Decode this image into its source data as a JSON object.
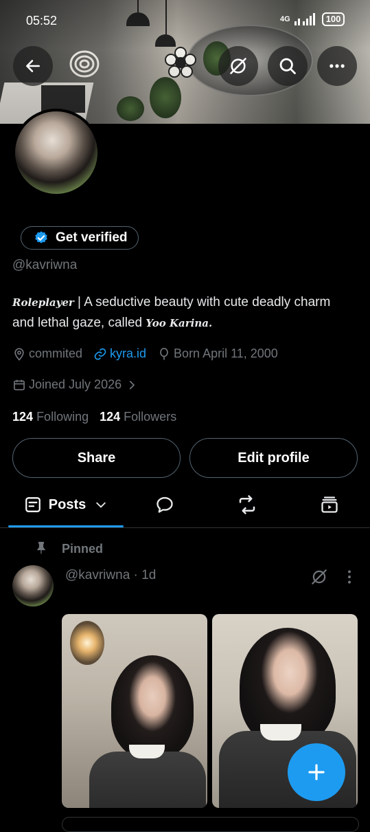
{
  "status_bar": {
    "time": "05:52",
    "network": "4G",
    "battery": "100"
  },
  "profile": {
    "verify_label": "Get verified",
    "handle": "@kavriwna",
    "bio": {
      "script_prefix": "Roleplayer",
      "text_1": " | A seductive beauty with cute deadly charm and lethal gaze, called ",
      "script_suffix": "Yoo Karina."
    },
    "location": "commited",
    "link": "kyra.id",
    "birthday": "Born April 11, 2000",
    "joined": "Joined July 2026",
    "following_count": "124",
    "following_label": "Following",
    "followers_count": "124",
    "followers_label": "Followers"
  },
  "buttons": {
    "share": "Share",
    "edit_profile": "Edit profile"
  },
  "tabs": {
    "posts": "Posts"
  },
  "pinned": {
    "label": "Pinned",
    "author": "@kavriwna",
    "time": "· 1d"
  },
  "colors": {
    "accent": "#1d9bf0",
    "background": "#000000",
    "muted": "#71767b"
  },
  "icons": {
    "back": "arrow-left-icon",
    "grok": "slash-circle-icon",
    "search": "search-icon",
    "more": "more-horizontal-icon",
    "verified": "verified-badge-icon",
    "location": "location-pin-icon",
    "link": "link-icon",
    "birthday": "balloon-icon",
    "calendar": "calendar-icon",
    "pin": "pin-icon",
    "compose": "plus-icon"
  }
}
